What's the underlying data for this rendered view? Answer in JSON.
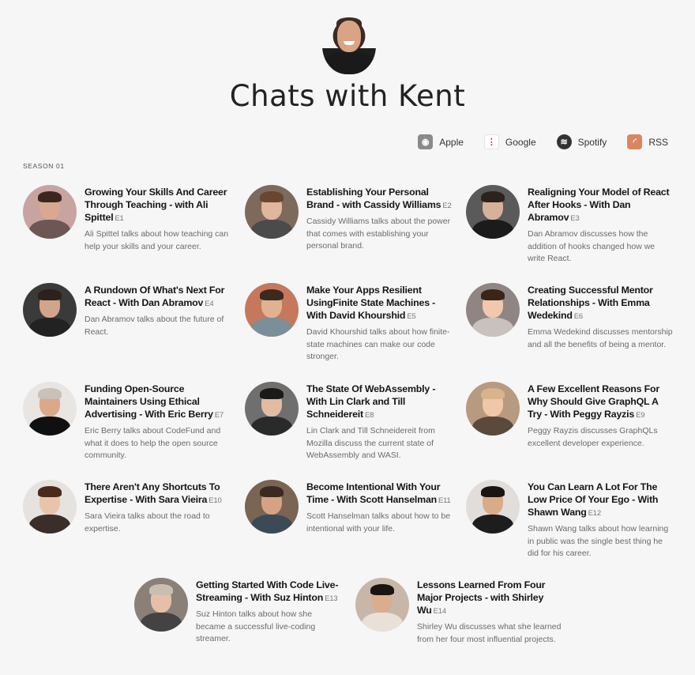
{
  "page": {
    "title": "Chats with Kent",
    "season_label": "SEASON 01"
  },
  "platforms": [
    {
      "label": "Apple",
      "icon": "apple-podcasts-icon"
    },
    {
      "label": "Google",
      "icon": "google-podcasts-icon"
    },
    {
      "label": "Spotify",
      "icon": "spotify-icon"
    },
    {
      "label": "RSS",
      "icon": "rss-icon"
    }
  ],
  "episodes": [
    {
      "title": "Growing Your Skills And Career Through Teaching - with Ali Spittel",
      "num": "E1",
      "desc": "Ali Spittel talks about how teaching can help your skills and your career."
    },
    {
      "title": "Establishing Your Personal Brand - with Cassidy Williams",
      "num": "E2",
      "desc": "Cassidy Williams talks about the power that comes with establishing your personal brand."
    },
    {
      "title": "Realigning Your Model of React After Hooks - With Dan Abramov",
      "num": "E3",
      "desc": "Dan Abramov discusses how the addition of hooks changed how we write React."
    },
    {
      "title": "A Rundown Of What's Next For React - With Dan Abramov",
      "num": "E4",
      "desc": "Dan Abramov talks about the future of React."
    },
    {
      "title": "Make Your Apps Resilient UsingFinite State Machines - With David Khourshid",
      "num": "E5",
      "desc": "David Khourshid talks about how finite-state machines can make our code stronger."
    },
    {
      "title": "Creating Successful Mentor Relationships - With Emma Wedekind",
      "num": "E6",
      "desc": "Emma Wedekind discusses mentorship and all the benefits of being a mentor."
    },
    {
      "title": "Funding Open-Source Maintainers Using Ethical Advertising - With Eric Berry",
      "num": "E7",
      "desc": "Eric Berry talks about CodeFund and what it does to help the open source community."
    },
    {
      "title": "The State Of WebAssembly - With Lin Clark and Till Schneidereit",
      "num": "E8",
      "desc": "Lin Clark and Till Schneidereit from Mozilla discuss the current state of WebAssembly and WASI."
    },
    {
      "title": "A Few Excellent Reasons For Why Should Give GraphQL A Try - With Peggy Rayzis",
      "num": "E9",
      "desc": "Peggy Rayzis discusses GraphQLs excellent developer experience."
    },
    {
      "title": "There Aren't Any Shortcuts To Expertise - With Sara Vieira",
      "num": "E10",
      "desc": "Sara Vieira talks about the road to expertise."
    },
    {
      "title": "Become Intentional With Your Time - With Scott Hanselman",
      "num": "E11",
      "desc": "Scott Hanselman talks about how to be intentional with your life."
    },
    {
      "title": "You Can Learn A Lot For The Low Price Of Your Ego - With Shawn Wang",
      "num": "E12",
      "desc": "Shawn Wang talks about how learning in public was the single best thing he did for his career."
    },
    {
      "title": "Getting Started With Code Live-Streaming - With Suz Hinton",
      "num": "E13",
      "desc": "Suz Hinton talks about how she became a successful live-coding streamer."
    },
    {
      "title": "Lessons Learned From Four Major Projects - with Shirley Wu",
      "num": "E14",
      "desc": "Shirley Wu discusses what she learned from her four most influential projects."
    }
  ]
}
